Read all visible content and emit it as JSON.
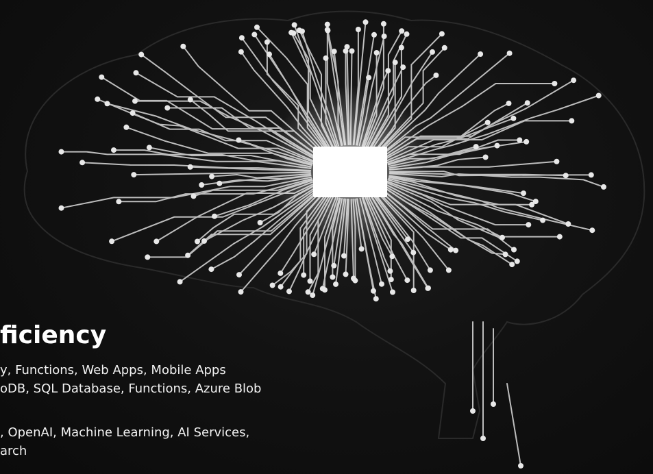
{
  "image": {
    "subject": "circuit-brain-icon",
    "core": "glowing-chip-icon"
  },
  "text": {
    "heading": "ficiency",
    "lines": [
      "y, Functions, Web Apps, Mobile Apps",
      "oDB, SQL Database, Functions, Azure Blob",
      ", OpenAI, Machine Learning, AI Services,",
      "arch"
    ]
  },
  "colors": {
    "background": "#0e0e0e",
    "trace": "#cfcfcf",
    "chip": "#ffffff",
    "text": "#ffffff"
  }
}
